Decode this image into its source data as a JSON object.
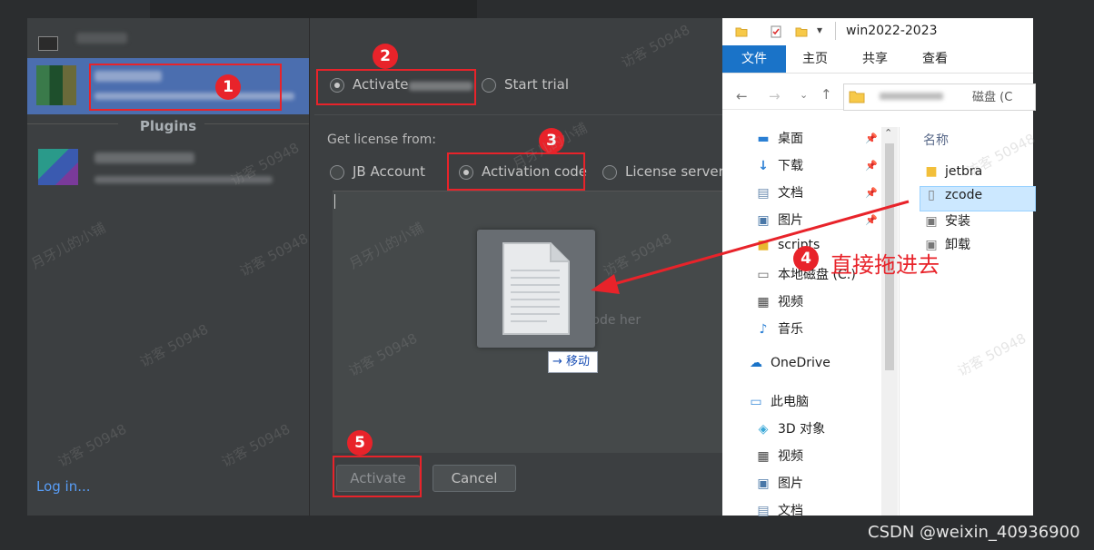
{
  "ide": {
    "plugins_label": "Plugins",
    "login_link": "Log in...",
    "activate_option": "Activate",
    "start_trial": "Start trial",
    "get_license_from": "Get license from:",
    "license_options": [
      "JB Account",
      "Activation code",
      "License server"
    ],
    "drop_hint": "op activation code her",
    "move_tooltip": "移动",
    "activate_button": "Activate",
    "cancel_button": "Cancel"
  },
  "explorer": {
    "title": "win2022-2023",
    "tabs": [
      "文件",
      "主页",
      "共享",
      "查看"
    ],
    "address_text": "磁盘 (C",
    "nav_items": [
      {
        "label": "桌面",
        "icon": "desktop-icon",
        "pinned": true
      },
      {
        "label": "下载",
        "icon": "download-icon",
        "pinned": true
      },
      {
        "label": "文档",
        "icon": "document-icon",
        "pinned": true
      },
      {
        "label": "图片",
        "icon": "picture-icon",
        "pinned": true
      },
      {
        "label": "scripts",
        "icon": "folder-icon",
        "pinned": false
      },
      {
        "label": "本地磁盘 (C:)",
        "icon": "drive-icon",
        "pinned": false
      },
      {
        "label": "视频",
        "icon": "video-icon",
        "pinned": false
      },
      {
        "label": "音乐",
        "icon": "music-icon",
        "pinned": false
      },
      {
        "label": "OneDrive",
        "icon": "cloud-icon",
        "pinned": false
      },
      {
        "label": "此电脑",
        "icon": "computer-icon",
        "pinned": false
      },
      {
        "label": "3D 对象",
        "icon": "cube-icon",
        "pinned": false
      },
      {
        "label": "视频",
        "icon": "video-icon",
        "pinned": false
      },
      {
        "label": "图片",
        "icon": "picture-icon",
        "pinned": false
      },
      {
        "label": "文档",
        "icon": "document-icon",
        "pinned": false
      }
    ],
    "column_name": "名称",
    "files": [
      {
        "label": "jetbra",
        "icon": "folder-icon"
      },
      {
        "label": "zcode",
        "icon": "text-file-icon",
        "selected": true
      },
      {
        "label": "安装",
        "icon": "script-file-icon"
      },
      {
        "label": "卸载",
        "icon": "script-file-icon"
      }
    ]
  },
  "annotations": {
    "badges": [
      "1",
      "2",
      "3",
      "4",
      "5"
    ],
    "drag_instruction": "直接拖进去",
    "color": "#e8232a"
  },
  "watermark": {
    "texts": [
      "访客 50948",
      "月牙儿的小铺"
    ],
    "credit": "CSDN @weixin_40936900"
  }
}
